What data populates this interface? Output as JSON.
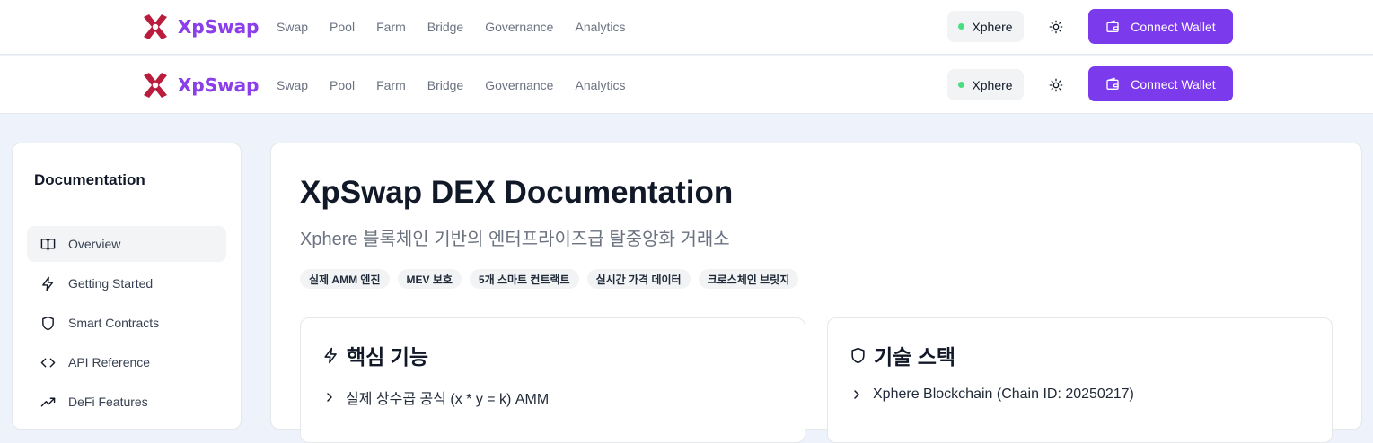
{
  "brand": {
    "name": "XpSwap"
  },
  "nav": {
    "items": [
      "Swap",
      "Pool",
      "Farm",
      "Bridge",
      "Governance",
      "Analytics"
    ]
  },
  "network": {
    "name": "Xphere",
    "status_color": "#4ade80"
  },
  "wallet": {
    "label": "Connect Wallet"
  },
  "colors": {
    "accent": "#7c3aed",
    "logo": "#b91c3c"
  },
  "sidebar": {
    "title": "Documentation",
    "items": [
      {
        "label": "Overview",
        "icon": "book-open-icon",
        "active": true
      },
      {
        "label": "Getting Started",
        "icon": "zap-icon"
      },
      {
        "label": "Smart Contracts",
        "icon": "shield-icon"
      },
      {
        "label": "API Reference",
        "icon": "code-icon"
      },
      {
        "label": "DeFi Features",
        "icon": "trending-up-icon"
      }
    ]
  },
  "main": {
    "title": "XpSwap DEX Documentation",
    "subtitle": "Xphere 블록체인 기반의 엔터프라이즈급 탈중앙화 거래소",
    "tags": [
      "실제 AMM 엔진",
      "MEV 보호",
      "5개 스마트 컨트랙트",
      "실시간 가격 데이터",
      "크로스체인 브릿지"
    ],
    "cards": [
      {
        "title": "핵심 기능",
        "icon": "zap-icon",
        "first_item": "실제 상수곱 공식 (x * y = k) AMM"
      },
      {
        "title": "기술 스택",
        "icon": "shield-icon",
        "first_item": "Xphere Blockchain (Chain ID: 20250217)"
      }
    ]
  }
}
